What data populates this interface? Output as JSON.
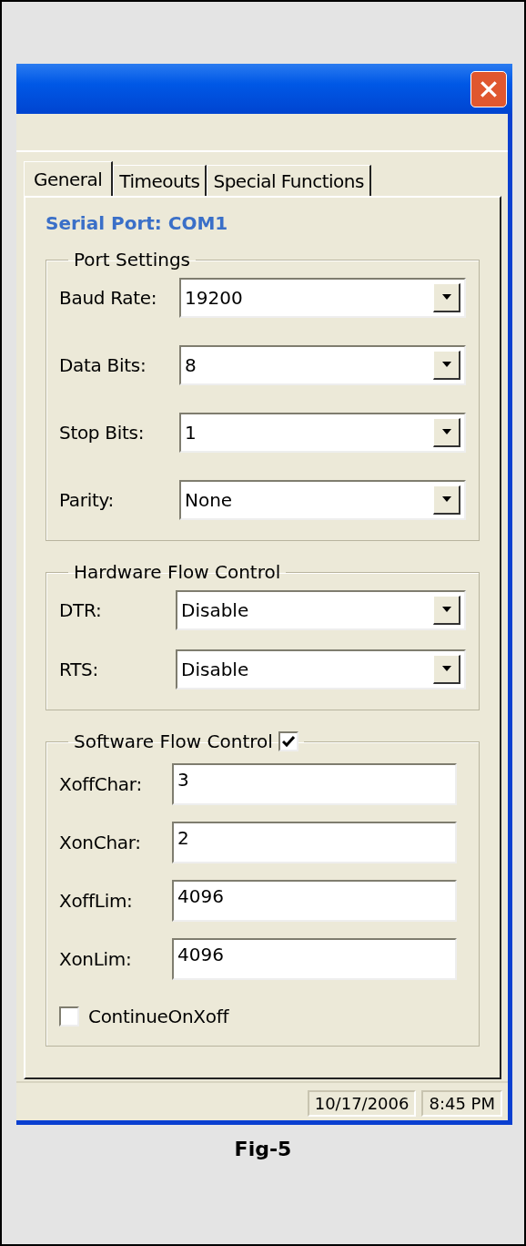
{
  "tabs": [
    {
      "label": "General",
      "selected": true
    },
    {
      "label": "Timeouts",
      "selected": false
    },
    {
      "label": "Special Functions",
      "selected": false
    }
  ],
  "heading": "Serial Port: COM1",
  "port_settings": {
    "title": "Port Settings",
    "fields": [
      {
        "label": "Baud Rate:",
        "value": "19200"
      },
      {
        "label": "Data Bits:",
        "value": "8"
      },
      {
        "label": "Stop Bits:",
        "value": "1"
      },
      {
        "label": "Parity:",
        "value": "None"
      }
    ]
  },
  "hardware_flow_control": {
    "title": "Hardware Flow Control",
    "fields": [
      {
        "label": "DTR:",
        "value": "Disable"
      },
      {
        "label": "RTS:",
        "value": "Disable"
      }
    ]
  },
  "software_flow_control": {
    "title": "Software Flow Control",
    "checked": true,
    "fields": [
      {
        "label": "XoffChar:",
        "value": "3"
      },
      {
        "label": "XonChar:",
        "value": "2"
      },
      {
        "label": "XoffLim:",
        "value": "4096"
      },
      {
        "label": "XonLim:",
        "value": "4096"
      }
    ],
    "option": {
      "label": "ContinueOnXoff",
      "checked": false
    }
  },
  "status_bar": {
    "date": "10/17/2006",
    "time": "8:45 PM"
  },
  "caption": "Fig-5"
}
